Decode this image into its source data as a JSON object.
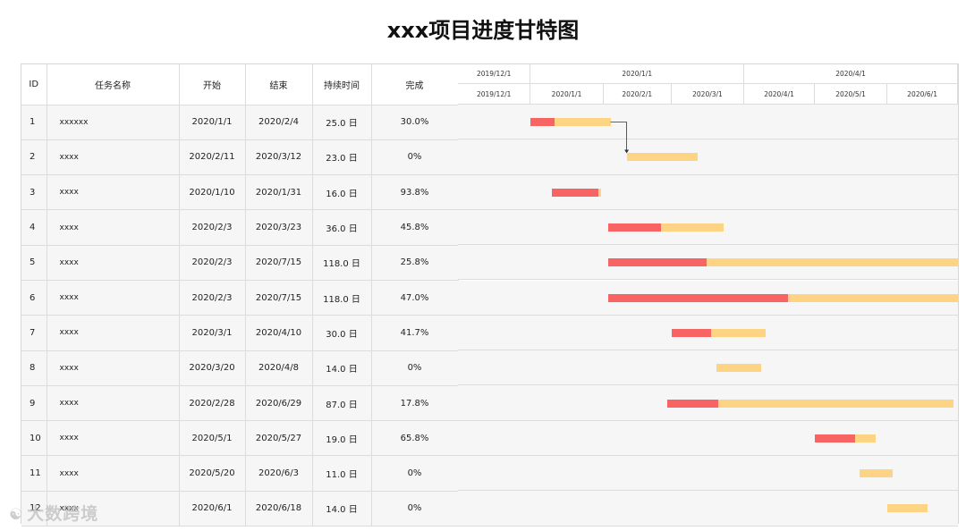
{
  "title": "xxx项目进度甘特图",
  "table": {
    "headers": [
      "ID",
      "任务名称",
      "开始",
      "结束",
      "持续时间",
      "完成"
    ],
    "rows": [
      {
        "id": "1",
        "name": "xxxxxx",
        "start": "2020/1/1",
        "end": "2020/2/4",
        "duration": "25.0 日",
        "complete": "30.0%"
      },
      {
        "id": "2",
        "name": "xxxx",
        "start": "2020/2/11",
        "end": "2020/3/12",
        "duration": "23.0 日",
        "complete": "0%"
      },
      {
        "id": "3",
        "name": "xxxx",
        "start": "2020/1/10",
        "end": "2020/1/31",
        "duration": "16.0 日",
        "complete": "93.8%"
      },
      {
        "id": "4",
        "name": "xxxx",
        "start": "2020/2/3",
        "end": "2020/3/23",
        "duration": "36.0 日",
        "complete": "45.8%"
      },
      {
        "id": "5",
        "name": "xxxx",
        "start": "2020/2/3",
        "end": "2020/7/15",
        "duration": "118.0 日",
        "complete": "25.8%"
      },
      {
        "id": "6",
        "name": "xxxx",
        "start": "2020/2/3",
        "end": "2020/7/15",
        "duration": "118.0 日",
        "complete": "47.0%"
      },
      {
        "id": "7",
        "name": "xxxx",
        "start": "2020/3/1",
        "end": "2020/4/10",
        "duration": "30.0 日",
        "complete": "41.7%"
      },
      {
        "id": "8",
        "name": "xxxx",
        "start": "2020/3/20",
        "end": "2020/4/8",
        "duration": "14.0 日",
        "complete": "0%"
      },
      {
        "id": "9",
        "name": "xxxx",
        "start": "2020/2/28",
        "end": "2020/6/29",
        "duration": "87.0 日",
        "complete": "17.8%"
      },
      {
        "id": "10",
        "name": "xxxx",
        "start": "2020/5/1",
        "end": "2020/5/27",
        "duration": "19.0 日",
        "complete": "65.8%"
      },
      {
        "id": "11",
        "name": "xxxx",
        "start": "2020/5/20",
        "end": "2020/6/3",
        "duration": "11.0 日",
        "complete": "0%"
      },
      {
        "id": "12",
        "name": "xxxx",
        "start": "2020/6/1",
        "end": "2020/6/18",
        "duration": "14.0 日",
        "complete": "0%"
      }
    ]
  },
  "timeline": {
    "major_labels": [
      "2019/12/1",
      "2020/1/1",
      "2020/4/1"
    ],
    "minor_labels": [
      "2019/12/1",
      "2020/1/1",
      "2020/2/1",
      "2020/3/1",
      "2020/4/1",
      "2020/5/1",
      "2020/6/1"
    ]
  },
  "chart_data": {
    "type": "gantt",
    "title": "xxx项目进度甘特图",
    "x_range": [
      "2019/12/1",
      "2020/7/1"
    ],
    "tasks": [
      {
        "id": 1,
        "start": "2020-01-01",
        "end": "2020-02-04",
        "complete": 0.3
      },
      {
        "id": 2,
        "start": "2020-02-11",
        "end": "2020-03-12",
        "complete": 0.0
      },
      {
        "id": 3,
        "start": "2020-01-10",
        "end": "2020-01-31",
        "complete": 0.938
      },
      {
        "id": 4,
        "start": "2020-02-03",
        "end": "2020-03-23",
        "complete": 0.458
      },
      {
        "id": 5,
        "start": "2020-02-03",
        "end": "2020-07-15",
        "complete": 0.258
      },
      {
        "id": 6,
        "start": "2020-02-03",
        "end": "2020-07-15",
        "complete": 0.47
      },
      {
        "id": 7,
        "start": "2020-03-01",
        "end": "2020-04-10",
        "complete": 0.417
      },
      {
        "id": 8,
        "start": "2020-03-20",
        "end": "2020-04-08",
        "complete": 0.0
      },
      {
        "id": 9,
        "start": "2020-02-28",
        "end": "2020-06-29",
        "complete": 0.178
      },
      {
        "id": 10,
        "start": "2020-05-01",
        "end": "2020-05-27",
        "complete": 0.658
      },
      {
        "id": 11,
        "start": "2020-05-20",
        "end": "2020-06-03",
        "complete": 0.0
      },
      {
        "id": 12,
        "start": "2020-06-01",
        "end": "2020-06-18",
        "complete": 0.0
      }
    ],
    "dependencies": [
      {
        "from": 1,
        "to": 2
      }
    ],
    "colors": {
      "complete": "#f86363",
      "remaining": "#fcd483"
    }
  },
  "watermark": {
    "text": "大数跨境",
    "logo": "☯"
  }
}
